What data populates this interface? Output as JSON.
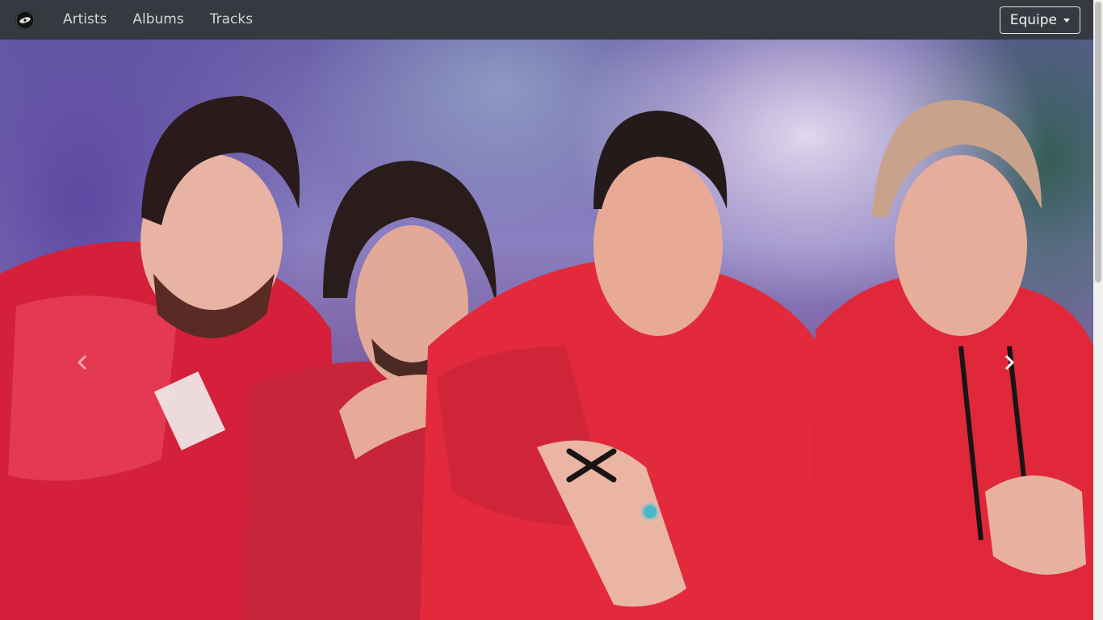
{
  "navbar": {
    "brand_icon": "disc-logo-icon",
    "links": [
      {
        "label": "Artists"
      },
      {
        "label": "Albums"
      },
      {
        "label": "Tracks"
      }
    ],
    "dropdown_label": "Equipe"
  },
  "carousel": {
    "prev_icon": "chevron-left-icon",
    "next_icon": "chevron-right-icon",
    "slide_description_colors": {
      "background_top": "#6a5fa8",
      "clothing": "#e0283a",
      "accent_dark": "#343a40"
    }
  }
}
